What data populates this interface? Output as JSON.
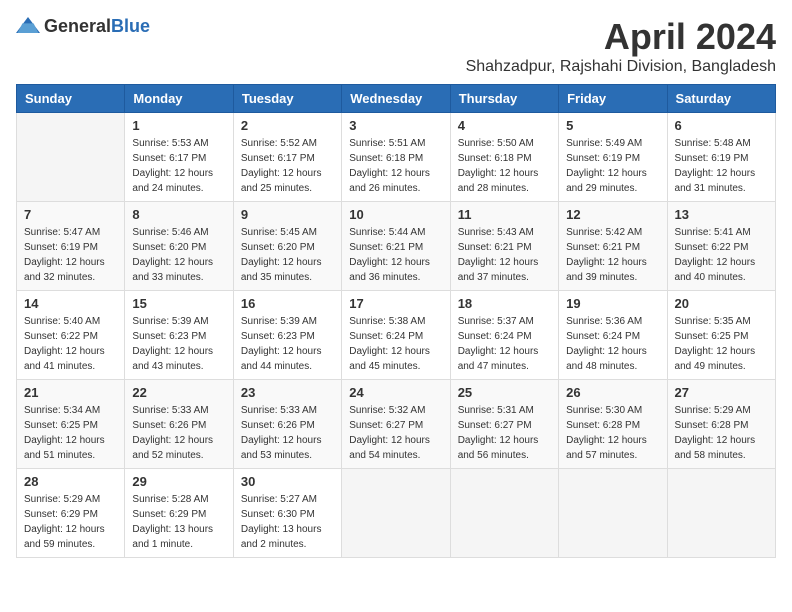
{
  "logo": {
    "text_general": "General",
    "text_blue": "Blue"
  },
  "title": "April 2024",
  "location": "Shahzadpur, Rajshahi Division, Bangladesh",
  "weekdays": [
    "Sunday",
    "Monday",
    "Tuesday",
    "Wednesday",
    "Thursday",
    "Friday",
    "Saturday"
  ],
  "weeks": [
    [
      {
        "day": "",
        "sunrise": "",
        "sunset": "",
        "daylight": ""
      },
      {
        "day": "1",
        "sunrise": "Sunrise: 5:53 AM",
        "sunset": "Sunset: 6:17 PM",
        "daylight": "Daylight: 12 hours and 24 minutes."
      },
      {
        "day": "2",
        "sunrise": "Sunrise: 5:52 AM",
        "sunset": "Sunset: 6:17 PM",
        "daylight": "Daylight: 12 hours and 25 minutes."
      },
      {
        "day": "3",
        "sunrise": "Sunrise: 5:51 AM",
        "sunset": "Sunset: 6:18 PM",
        "daylight": "Daylight: 12 hours and 26 minutes."
      },
      {
        "day": "4",
        "sunrise": "Sunrise: 5:50 AM",
        "sunset": "Sunset: 6:18 PM",
        "daylight": "Daylight: 12 hours and 28 minutes."
      },
      {
        "day": "5",
        "sunrise": "Sunrise: 5:49 AM",
        "sunset": "Sunset: 6:19 PM",
        "daylight": "Daylight: 12 hours and 29 minutes."
      },
      {
        "day": "6",
        "sunrise": "Sunrise: 5:48 AM",
        "sunset": "Sunset: 6:19 PM",
        "daylight": "Daylight: 12 hours and 31 minutes."
      }
    ],
    [
      {
        "day": "7",
        "sunrise": "Sunrise: 5:47 AM",
        "sunset": "Sunset: 6:19 PM",
        "daylight": "Daylight: 12 hours and 32 minutes."
      },
      {
        "day": "8",
        "sunrise": "Sunrise: 5:46 AM",
        "sunset": "Sunset: 6:20 PM",
        "daylight": "Daylight: 12 hours and 33 minutes."
      },
      {
        "day": "9",
        "sunrise": "Sunrise: 5:45 AM",
        "sunset": "Sunset: 6:20 PM",
        "daylight": "Daylight: 12 hours and 35 minutes."
      },
      {
        "day": "10",
        "sunrise": "Sunrise: 5:44 AM",
        "sunset": "Sunset: 6:21 PM",
        "daylight": "Daylight: 12 hours and 36 minutes."
      },
      {
        "day": "11",
        "sunrise": "Sunrise: 5:43 AM",
        "sunset": "Sunset: 6:21 PM",
        "daylight": "Daylight: 12 hours and 37 minutes."
      },
      {
        "day": "12",
        "sunrise": "Sunrise: 5:42 AM",
        "sunset": "Sunset: 6:21 PM",
        "daylight": "Daylight: 12 hours and 39 minutes."
      },
      {
        "day": "13",
        "sunrise": "Sunrise: 5:41 AM",
        "sunset": "Sunset: 6:22 PM",
        "daylight": "Daylight: 12 hours and 40 minutes."
      }
    ],
    [
      {
        "day": "14",
        "sunrise": "Sunrise: 5:40 AM",
        "sunset": "Sunset: 6:22 PM",
        "daylight": "Daylight: 12 hours and 41 minutes."
      },
      {
        "day": "15",
        "sunrise": "Sunrise: 5:39 AM",
        "sunset": "Sunset: 6:23 PM",
        "daylight": "Daylight: 12 hours and 43 minutes."
      },
      {
        "day": "16",
        "sunrise": "Sunrise: 5:39 AM",
        "sunset": "Sunset: 6:23 PM",
        "daylight": "Daylight: 12 hours and 44 minutes."
      },
      {
        "day": "17",
        "sunrise": "Sunrise: 5:38 AM",
        "sunset": "Sunset: 6:24 PM",
        "daylight": "Daylight: 12 hours and 45 minutes."
      },
      {
        "day": "18",
        "sunrise": "Sunrise: 5:37 AM",
        "sunset": "Sunset: 6:24 PM",
        "daylight": "Daylight: 12 hours and 47 minutes."
      },
      {
        "day": "19",
        "sunrise": "Sunrise: 5:36 AM",
        "sunset": "Sunset: 6:24 PM",
        "daylight": "Daylight: 12 hours and 48 minutes."
      },
      {
        "day": "20",
        "sunrise": "Sunrise: 5:35 AM",
        "sunset": "Sunset: 6:25 PM",
        "daylight": "Daylight: 12 hours and 49 minutes."
      }
    ],
    [
      {
        "day": "21",
        "sunrise": "Sunrise: 5:34 AM",
        "sunset": "Sunset: 6:25 PM",
        "daylight": "Daylight: 12 hours and 51 minutes."
      },
      {
        "day": "22",
        "sunrise": "Sunrise: 5:33 AM",
        "sunset": "Sunset: 6:26 PM",
        "daylight": "Daylight: 12 hours and 52 minutes."
      },
      {
        "day": "23",
        "sunrise": "Sunrise: 5:33 AM",
        "sunset": "Sunset: 6:26 PM",
        "daylight": "Daylight: 12 hours and 53 minutes."
      },
      {
        "day": "24",
        "sunrise": "Sunrise: 5:32 AM",
        "sunset": "Sunset: 6:27 PM",
        "daylight": "Daylight: 12 hours and 54 minutes."
      },
      {
        "day": "25",
        "sunrise": "Sunrise: 5:31 AM",
        "sunset": "Sunset: 6:27 PM",
        "daylight": "Daylight: 12 hours and 56 minutes."
      },
      {
        "day": "26",
        "sunrise": "Sunrise: 5:30 AM",
        "sunset": "Sunset: 6:28 PM",
        "daylight": "Daylight: 12 hours and 57 minutes."
      },
      {
        "day": "27",
        "sunrise": "Sunrise: 5:29 AM",
        "sunset": "Sunset: 6:28 PM",
        "daylight": "Daylight: 12 hours and 58 minutes."
      }
    ],
    [
      {
        "day": "28",
        "sunrise": "Sunrise: 5:29 AM",
        "sunset": "Sunset: 6:29 PM",
        "daylight": "Daylight: 12 hours and 59 minutes."
      },
      {
        "day": "29",
        "sunrise": "Sunrise: 5:28 AM",
        "sunset": "Sunset: 6:29 PM",
        "daylight": "Daylight: 13 hours and 1 minute."
      },
      {
        "day": "30",
        "sunrise": "Sunrise: 5:27 AM",
        "sunset": "Sunset: 6:30 PM",
        "daylight": "Daylight: 13 hours and 2 minutes."
      },
      {
        "day": "",
        "sunrise": "",
        "sunset": "",
        "daylight": ""
      },
      {
        "day": "",
        "sunrise": "",
        "sunset": "",
        "daylight": ""
      },
      {
        "day": "",
        "sunrise": "",
        "sunset": "",
        "daylight": ""
      },
      {
        "day": "",
        "sunrise": "",
        "sunset": "",
        "daylight": ""
      }
    ]
  ]
}
